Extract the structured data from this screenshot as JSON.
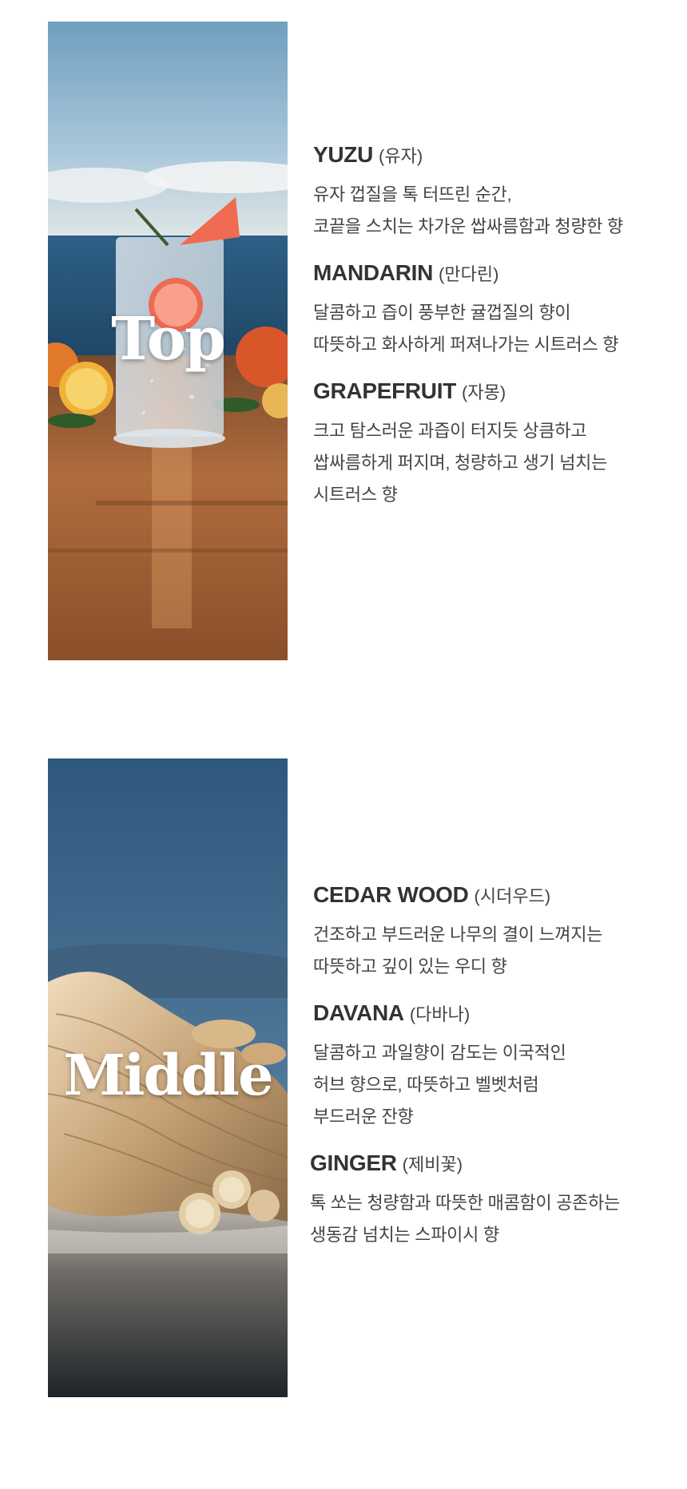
{
  "top": {
    "label": "Top",
    "notes": [
      {
        "name": "YUZU",
        "korean": "(유자)",
        "lines": [
          "유자 껍질을 톡 터뜨린 순간,",
          "코끝을 스치는 차가운 쌉싸름함과 청량한 향"
        ]
      },
      {
        "name": "MANDARIN",
        "korean": "(만다린)",
        "lines": [
          "달콤하고 즙이 풍부한 귤껍질의 향이",
          "따뜻하고 화사하게 퍼져나가는 시트러스 향"
        ]
      },
      {
        "name": "GRAPEFRUIT",
        "korean": "(자몽)",
        "lines": [
          "크고 탐스러운 과즙이 터지듯 상큼하고",
          "쌉싸름하게 퍼지며, 청량하고 생기 넘치는",
          "시트러스 향"
        ]
      }
    ]
  },
  "middle": {
    "label": "Middle",
    "notes": [
      {
        "name": "CEDAR WOOD",
        "korean": "(시더우드)",
        "lines": [
          "건조하고 부드러운 나무의 결이 느껴지는",
          "따뜻하고 깊이 있는 우디 향"
        ]
      },
      {
        "name": "DAVANA",
        "korean": "(다바나)",
        "lines": [
          "달콤하고 과일향이 감도는 이국적인",
          "허브 향으로, 따뜻하고 벨벳처럼",
          "부드러운 잔향"
        ]
      },
      {
        "name": "GINGER",
        "korean": "(제비꽃)",
        "lines": [
          "톡 쏘는 청량함과 따뜻한 매콤함이 공존하는",
          "생동감 넘치는 스파이시 향"
        ]
      }
    ]
  }
}
